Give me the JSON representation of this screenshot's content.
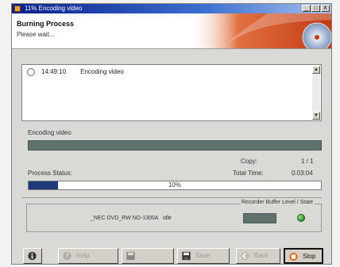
{
  "window": {
    "title": "11% Encoding video",
    "buttons": {
      "minimize": "_",
      "maximize": "□",
      "close": "X"
    }
  },
  "header": {
    "title": "Burning Process",
    "subtitle": "Please wait..."
  },
  "log": {
    "entries": [
      {
        "time": "14:49:10",
        "message": "Encoding video"
      }
    ]
  },
  "status": {
    "current_task": "Encoding video",
    "copy_label": "Copy:",
    "copy_value": "1 / 1",
    "process_status_label": "Process Status:",
    "total_time_label": "Total Time:",
    "total_time_value": "0:03:04",
    "progress_percent": 10,
    "progress_text": "10%"
  },
  "recorder": {
    "group_title": "Recorder Buffer Level / State",
    "device": "_NEC DVD_RW ND-1300A",
    "state": "idle",
    "state_color": "#3aa03a"
  },
  "toolbar": {
    "help_label": "Help",
    "save_label": "Save",
    "back_label": "Back",
    "stop_label": "Stop"
  },
  "colors": {
    "accent": "#1f3a7a",
    "bar": "#5f716c"
  }
}
